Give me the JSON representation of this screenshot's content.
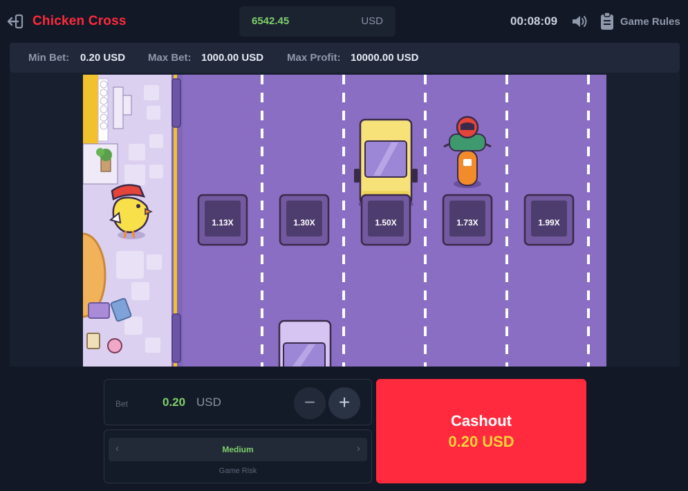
{
  "header": {
    "title": "Chicken Cross",
    "balance": "6542.45",
    "currency": "USD",
    "timer": "00:08:09",
    "rules_label": "Game Rules"
  },
  "limits": {
    "min_label": "Min Bet:",
    "min_value": "0.20 USD",
    "max_label": "Max Bet:",
    "max_value": "1000.00 USD",
    "profit_label": "Max Profit:",
    "profit_value": "10000.00 USD"
  },
  "game": {
    "multipliers": [
      "1.13X",
      "1.30X",
      "1.50X",
      "1.73X",
      "1.99X"
    ]
  },
  "bet": {
    "label": "Bet",
    "value": "0.20",
    "currency": "USD",
    "minus": "−",
    "plus": "+"
  },
  "risk": {
    "value": "Medium",
    "caption": "Game Risk",
    "left": "‹",
    "right": "›"
  },
  "cashout": {
    "label": "Cashout",
    "amount": "0.20",
    "currency": "USD"
  },
  "colors": {
    "accent_red": "#ff2a3d",
    "balance_green": "#7fd06a",
    "road_purple": "#8a6ec3",
    "cashout_amount": "#ffd33d"
  },
  "icons": [
    "back-arrow-icon",
    "speaker-icon",
    "clipboard-icon",
    "chicken-icon",
    "car-icon",
    "scooter-icon"
  ]
}
